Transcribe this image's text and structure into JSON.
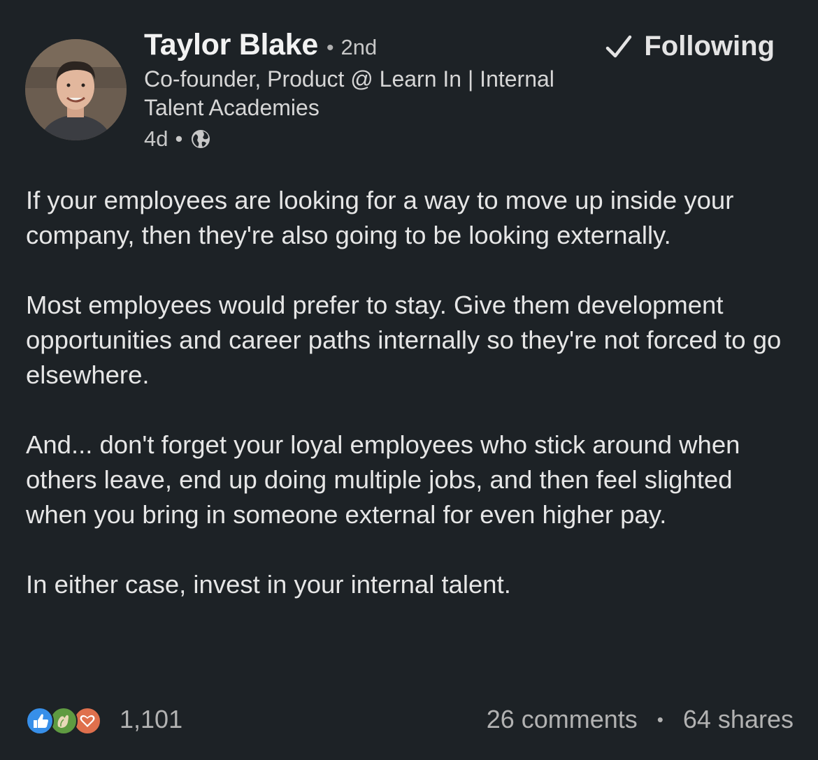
{
  "post": {
    "author": {
      "name": "Taylor Blake",
      "connection_degree": "2nd",
      "headline": "Co-founder, Product @ Learn In | Internal Talent Academies",
      "time_ago": "4d",
      "visibility_icon": "globe-icon",
      "avatar_icon": "avatar-photo"
    },
    "follow": {
      "label": "Following",
      "icon": "check-icon"
    },
    "paragraphs": [
      "If your employees are looking for a way to move up inside your company, then they're also going to be looking externally.",
      "Most employees would prefer to stay. Give them development opportunities and career paths internally so they're not forced to go elsewhere.",
      "And... don't forget your loyal employees who stick around when others leave, end up doing multiple jobs, and then feel slighted when you bring in someone external for even higher pay.",
      "In either case, invest in your internal talent."
    ],
    "social": {
      "reaction_icons": [
        "like-icon",
        "celebrate-icon",
        "love-icon"
      ],
      "reaction_count": "1,101",
      "comments": "26 comments",
      "separator": "•",
      "shares": "64 shares"
    },
    "colors": {
      "background": "#1d2226",
      "like": "#378fe9",
      "celebrate": "#5f9b41",
      "love": "#df704d"
    }
  }
}
